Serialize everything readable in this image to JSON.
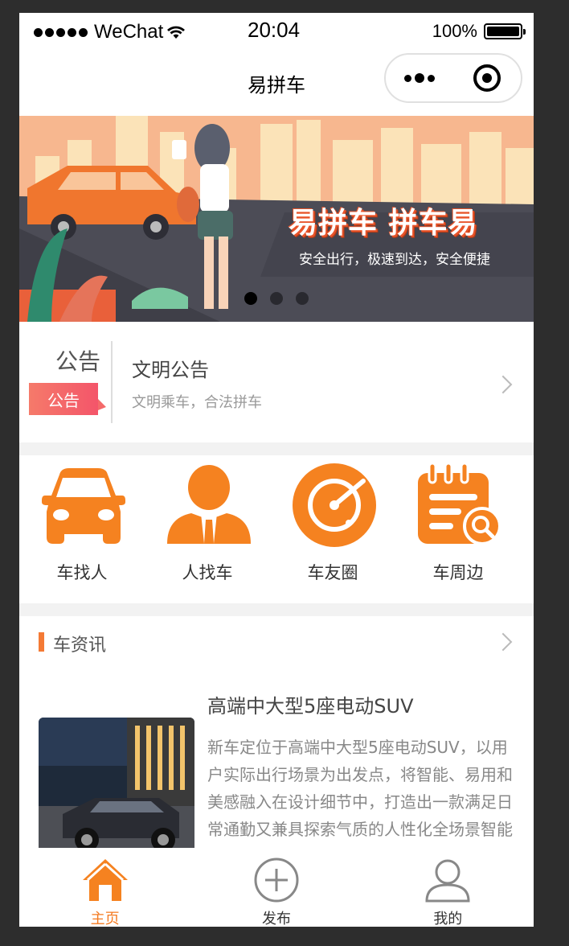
{
  "status_bar": {
    "carrier": "WeChat",
    "time": "20:04",
    "battery": "100%"
  },
  "nav": {
    "title": "易拼车",
    "more_icon": "more-dots-icon",
    "close_icon": "target-close-icon"
  },
  "banner": {
    "title": "易拼车 拼车易",
    "subtitle": "安全出行，极速到达，安全便捷",
    "slide_count": 3,
    "active_slide": 1
  },
  "notice": {
    "label": "公告",
    "tag": "公告",
    "title": "文明公告",
    "subtitle": "文明乘车，合法拼车"
  },
  "grid": [
    {
      "label": "车找人",
      "icon": "car-icon"
    },
    {
      "label": "人找车",
      "icon": "person-icon"
    },
    {
      "label": "车友圈",
      "icon": "radar-icon"
    },
    {
      "label": "车周边",
      "icon": "calendar-search-icon"
    }
  ],
  "news": {
    "section_title": "车资讯",
    "item": {
      "title": "高端中大型5座电动SUV",
      "description": "新车定位于高端中大型5座电动SUV，以用户实际出行场景为出发点，将智能、易用和美感融入在设计细节中，打造出一款满足日常通勤又兼具探索气质的人性化全场景智能电动SUV"
    }
  },
  "tabbar": [
    {
      "label": "主页",
      "icon": "home-icon",
      "active": true
    },
    {
      "label": "发布",
      "icon": "plus-circle-icon",
      "active": false
    },
    {
      "label": "我的",
      "icon": "user-icon",
      "active": false
    }
  ],
  "colors": {
    "accent": "#f58220",
    "tag": "#f4556a",
    "tab_active": "#f47a20"
  }
}
